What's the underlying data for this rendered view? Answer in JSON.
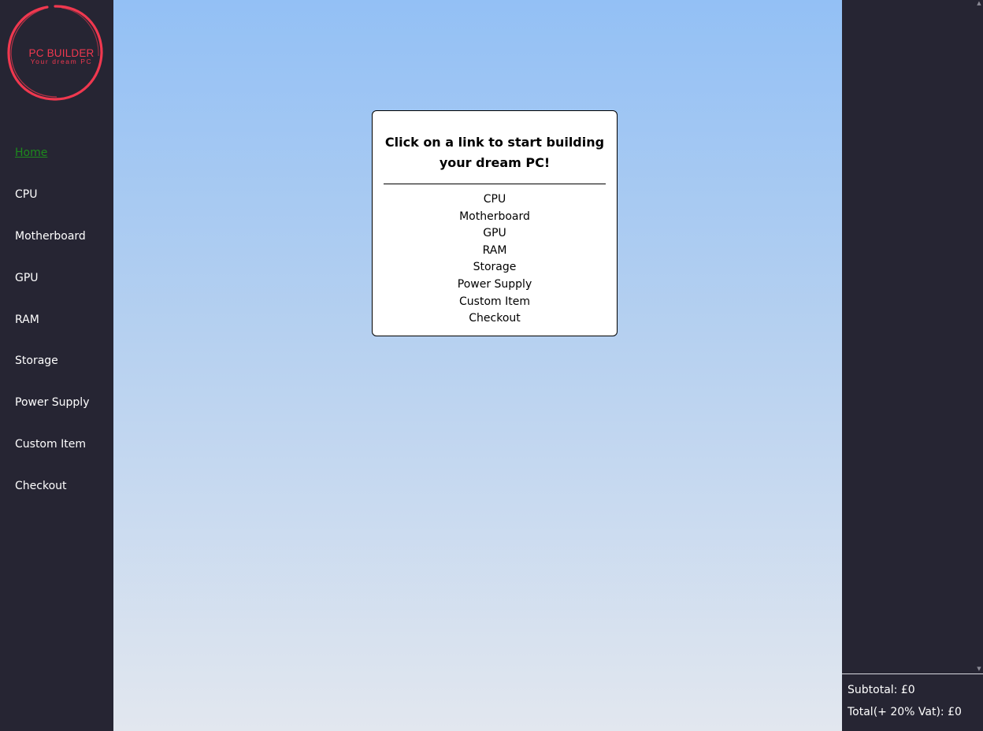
{
  "brand": {
    "title": "PC BUILDER",
    "tagline": "Your dream PC",
    "color": "#f0384f"
  },
  "sidebar": {
    "items": [
      {
        "label": "Home",
        "active": true
      },
      {
        "label": "CPU"
      },
      {
        "label": "Motherboard"
      },
      {
        "label": "GPU"
      },
      {
        "label": "RAM"
      },
      {
        "label": "Storage"
      },
      {
        "label": "Power Supply"
      },
      {
        "label": "Custom Item"
      },
      {
        "label": "Checkout"
      }
    ]
  },
  "main": {
    "card": {
      "heading": "Click on a link to start building your dream PC!",
      "links": [
        "CPU",
        "Motherboard",
        "GPU",
        "RAM",
        "Storage",
        "Power Supply",
        "Custom Item",
        "Checkout"
      ]
    }
  },
  "cart": {
    "subtotal": "Subtotal: £0",
    "total": "Total(+ 20% Vat): £0"
  },
  "colors": {
    "sidebar_bg": "#262533",
    "active_link": "#1d8a1d",
    "gradient_top": "#93c0f5",
    "gradient_bottom": "#e2e7ef"
  }
}
